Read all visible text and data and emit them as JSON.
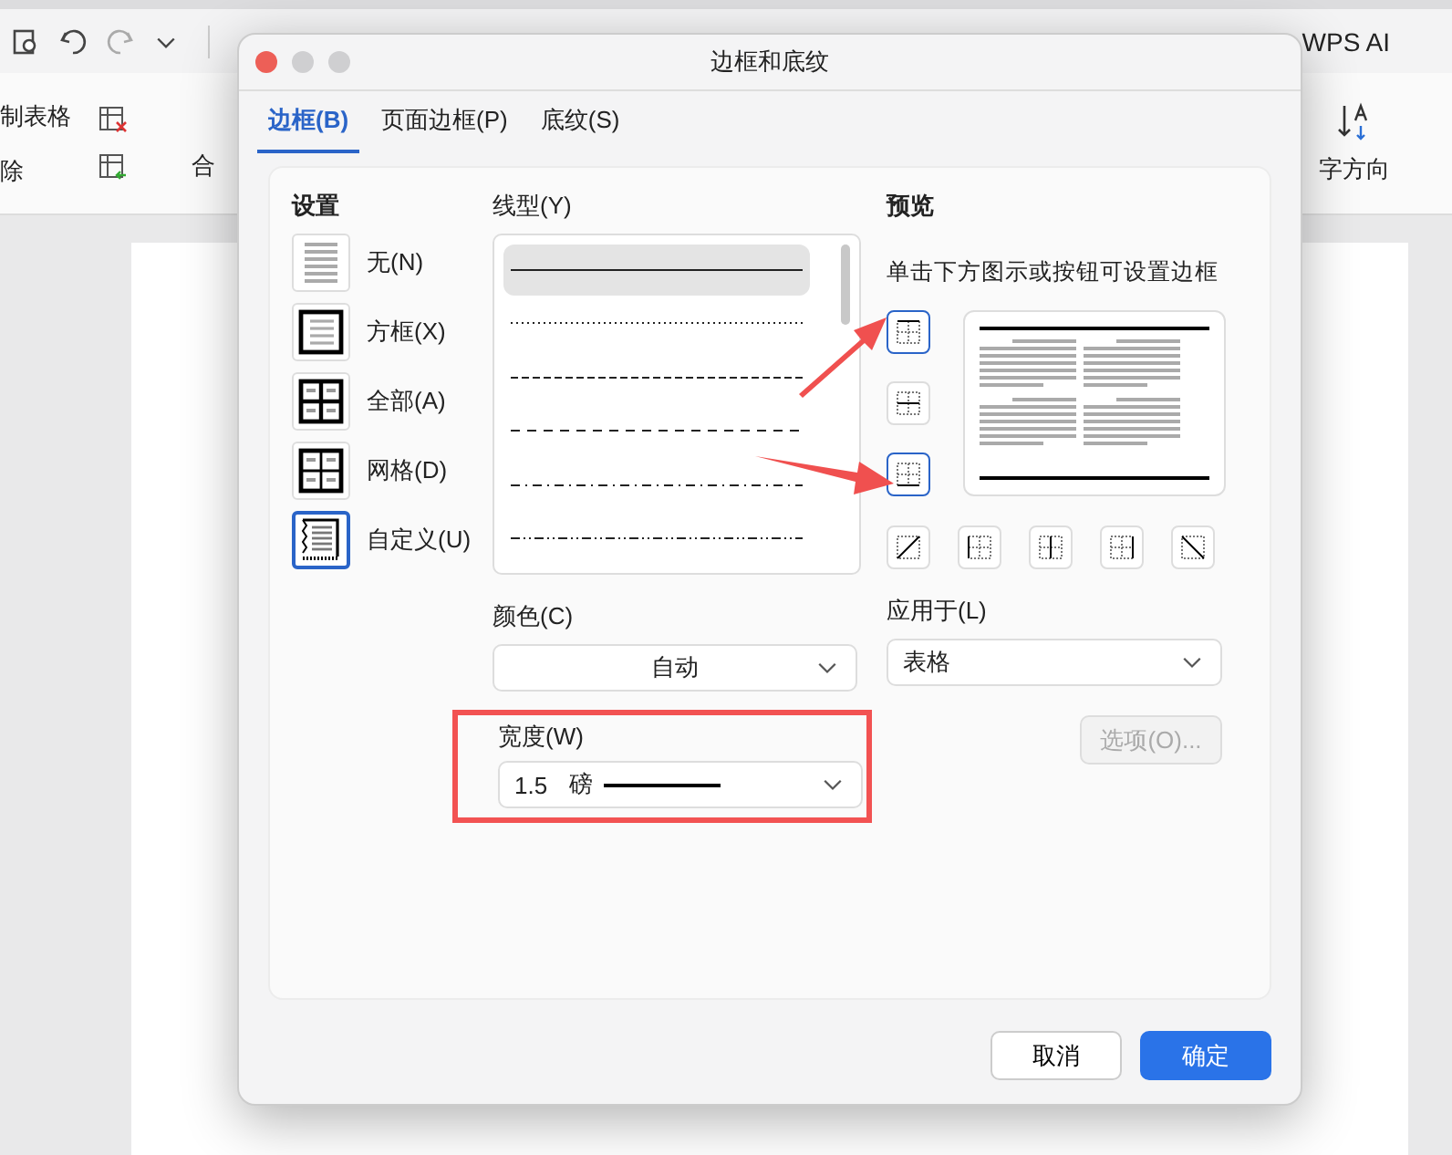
{
  "app": {
    "ribbon_left": [
      "制表格",
      "除"
    ],
    "ribbon_merge": "合",
    "ribbon_right": "字方向",
    "ai_label": "WPS AI"
  },
  "dialog": {
    "title": "边框和底纹",
    "tabs": [
      {
        "label": "边框(B)",
        "selected": true
      },
      {
        "label": "页面边框(P)",
        "selected": false
      },
      {
        "label": "底纹(S)",
        "selected": false
      }
    ],
    "settings": {
      "label": "设置",
      "items": [
        {
          "label": "无(N)",
          "kind": "none",
          "selected": false
        },
        {
          "label": "方框(X)",
          "kind": "box",
          "selected": false
        },
        {
          "label": "全部(A)",
          "kind": "all",
          "selected": false
        },
        {
          "label": "网格(D)",
          "kind": "grid",
          "selected": false
        },
        {
          "label": "自定义(U)",
          "kind": "custom",
          "selected": true
        }
      ]
    },
    "line_style": {
      "label": "线型(Y)",
      "items": [
        {
          "kind": "solid",
          "selected": true
        },
        {
          "kind": "dotted",
          "selected": false
        },
        {
          "kind": "dashed",
          "selected": false
        },
        {
          "kind": "long-dash",
          "selected": false
        },
        {
          "kind": "dash-dot",
          "selected": false
        },
        {
          "kind": "dash-dot-dot",
          "selected": false
        }
      ]
    },
    "color": {
      "label": "颜色(C)",
      "value": "自动"
    },
    "width": {
      "label": "宽度(W)",
      "value": "1.5",
      "unit": "磅"
    },
    "preview": {
      "label": "预览",
      "hint": "单击下方图示或按钮可设置边框",
      "side_buttons": [
        {
          "kind": "top",
          "selected": true
        },
        {
          "kind": "middle",
          "selected": false
        },
        {
          "kind": "bottom",
          "selected": true
        }
      ],
      "bottom_buttons": [
        {
          "kind": "diag-up",
          "selected": false
        },
        {
          "kind": "left",
          "selected": false
        },
        {
          "kind": "center",
          "selected": false
        },
        {
          "kind": "right",
          "selected": false
        },
        {
          "kind": "diag-down",
          "selected": false
        }
      ]
    },
    "apply_to": {
      "label": "应用于(L)",
      "value": "表格"
    },
    "options_button": {
      "label": "选项(O)...",
      "disabled": true
    },
    "buttons": [
      {
        "label": "取消",
        "kind": "secondary"
      },
      {
        "label": "确定",
        "kind": "primary"
      }
    ]
  }
}
